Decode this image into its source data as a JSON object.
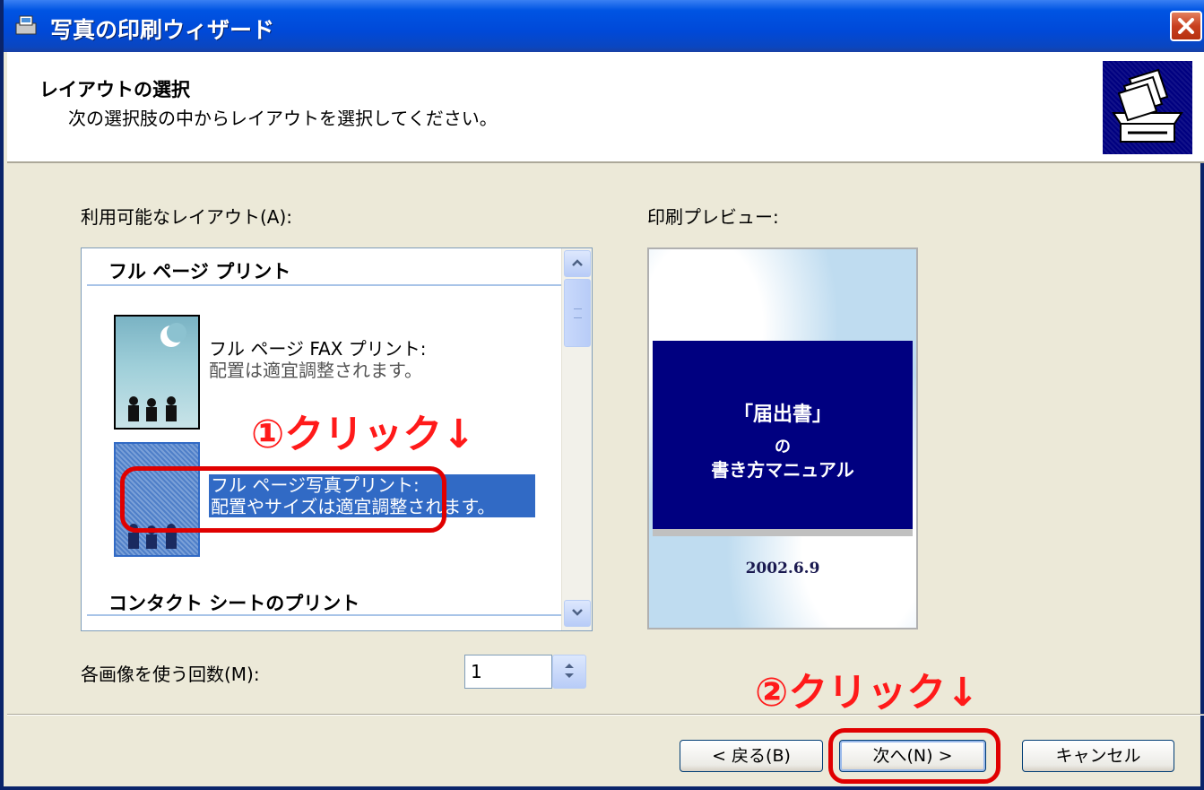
{
  "window": {
    "title": "写真の印刷ウィザード"
  },
  "header": {
    "title": "レイアウトの選択",
    "subtitle": "次の選択肢の中からレイアウトを選択してください。"
  },
  "layouts": {
    "label": "利用可能なレイアウト(A):",
    "groups": [
      {
        "heading": "フル ページ プリント"
      },
      {
        "heading": "コンタクト シートのプリント"
      }
    ],
    "items": [
      {
        "title": "フル ページ FAX プリント:",
        "desc": "配置は適宜調整されます。",
        "selected": false
      },
      {
        "title": "フル ページ写真プリント:",
        "desc": "配置やサイズは適宜調整されます。",
        "selected": true
      }
    ]
  },
  "preview": {
    "label": "印刷プレビュー:",
    "doc_title": "「届出書」",
    "doc_line2": "の",
    "doc_line3": "書き方マニュアル",
    "date": "2002.6.9"
  },
  "copies": {
    "label": "各画像を使う回数(M):",
    "value": "1"
  },
  "buttons": {
    "back": "< 戻る(B)",
    "next": "次へ(N) >",
    "cancel": "キャンセル"
  },
  "annotations": {
    "step1": "①クリック↓",
    "step2": "②クリック↓"
  },
  "colors": {
    "title_bar": "#0054e3",
    "selection": "#316ac5",
    "annotation": "#ff1a1a"
  }
}
